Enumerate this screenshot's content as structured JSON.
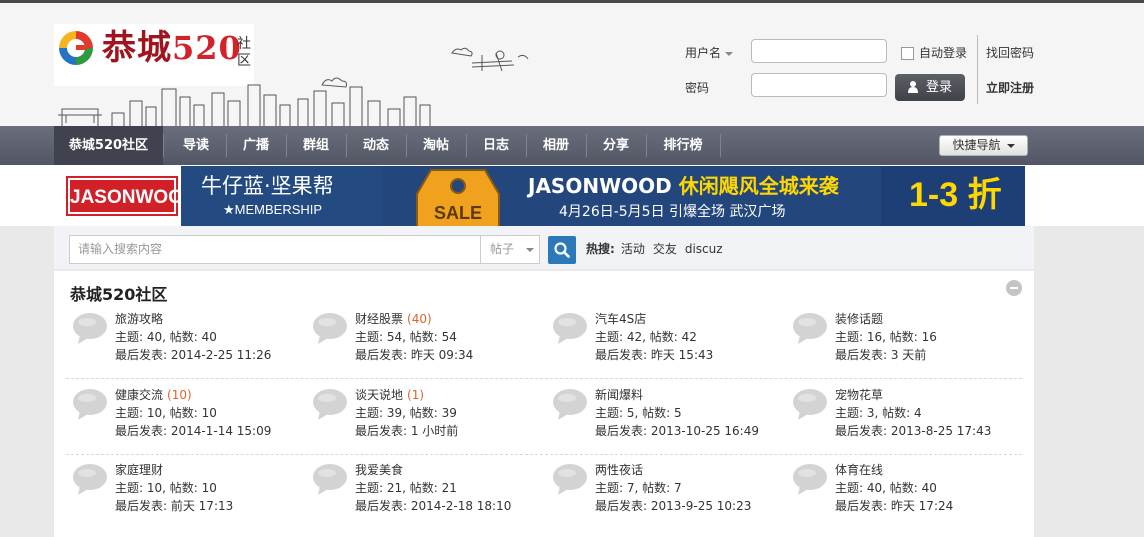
{
  "header": {
    "logo_text": "恭城",
    "logo_num": "520",
    "logo_sub": "社区"
  },
  "login": {
    "username_label": "用户名",
    "password_label": "密码",
    "auto_login_label": "自动登录",
    "login_button": "登录",
    "find_password": "找回密码",
    "register": "立即注册"
  },
  "nav": {
    "items": [
      "恭城520社区",
      "导读",
      "广播",
      "群组",
      "动态",
      "淘帖",
      "日志",
      "相册",
      "分享",
      "排行榜"
    ],
    "quick_nav": "快捷导航"
  },
  "banner": {
    "brand": "JASONWOOD",
    "slogan": "牛仔蓝·坚果帮",
    "membership": "★MEMBERSHIP",
    "tag": "SALE",
    "headline_brand": "JASONWOOD",
    "headline_text": "休闲飓风全城来袭",
    "date_text": "4月26日-5月5日 引爆全场 武汉广场",
    "discount": "1-3 折"
  },
  "search": {
    "placeholder": "请输入搜索内容",
    "type": "帖子",
    "hot_label": "热搜:",
    "hot_keywords": [
      "活动",
      "交友",
      "discuz"
    ]
  },
  "forum": {
    "title": "恭城520社区",
    "boards": [
      {
        "name": "旅游攻略",
        "today": "",
        "stats": "主题: 40, 帖数: 40",
        "last": "最后发表: 2014-2-25 11:26"
      },
      {
        "name": "财经股票",
        "today": "(40)",
        "stats": "主题: 54, 帖数: 54",
        "last": "最后发表: 昨天 09:34"
      },
      {
        "name": "汽车4S店",
        "today": "",
        "stats": "主题: 42, 帖数: 42",
        "last": "最后发表: 昨天 15:43"
      },
      {
        "name": "装修话题",
        "today": "",
        "stats": "主题: 16, 帖数: 16",
        "last": "最后发表: 3 天前"
      },
      {
        "name": "健康交流",
        "today": "(10)",
        "stats": "主题: 10, 帖数: 10",
        "last": "最后发表: 2014-1-14 15:09"
      },
      {
        "name": "谈天说地",
        "today": "(1)",
        "stats": "主题: 39, 帖数: 39",
        "last": "最后发表: 1 小时前"
      },
      {
        "name": "新闻爆料",
        "today": "",
        "stats": "主题: 5, 帖数: 5",
        "last": "最后发表: 2013-10-25 16:49"
      },
      {
        "name": "宠物花草",
        "today": "",
        "stats": "主题: 3, 帖数: 4",
        "last": "最后发表: 2013-8-25 17:43"
      },
      {
        "name": "家庭理财",
        "today": "",
        "stats": "主题: 10, 帖数: 10",
        "last": "最后发表: 前天 17:13"
      },
      {
        "name": "我爱美食",
        "today": "",
        "stats": "主题: 21, 帖数: 21",
        "last": "最后发表: 2014-2-18 18:10"
      },
      {
        "name": "两性夜话",
        "today": "",
        "stats": "主题: 7, 帖数: 7",
        "last": "最后发表: 2013-9-25 10:23"
      },
      {
        "name": "体育在线",
        "today": "",
        "stats": "主题: 40, 帖数: 40",
        "last": "最后发表: 昨天 17:24"
      }
    ]
  }
}
